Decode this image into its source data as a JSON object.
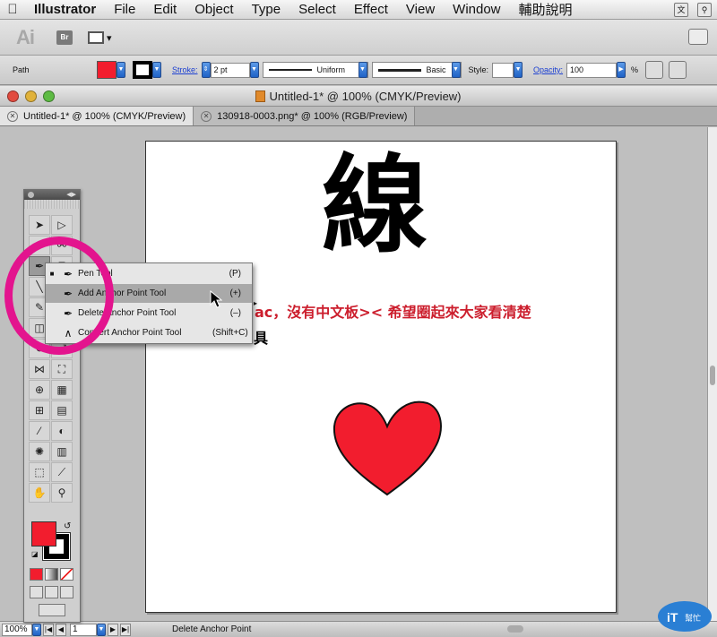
{
  "menubar": {
    "app": "Illustrator",
    "items": [
      "File",
      "Edit",
      "Object",
      "Type",
      "Select",
      "Effect",
      "View",
      "Window",
      "輔助說明"
    ]
  },
  "appbar": {
    "logo": "Ai",
    "bridge": "Br"
  },
  "control": {
    "label": "Path",
    "fill_color": "#f21d2e",
    "stroke_link": "Stroke:",
    "stroke_weight": "2 pt",
    "profile_uniform": "Uniform",
    "brush_basic": "Basic",
    "style_label": "Style:",
    "opacity_link": "Opacity:",
    "opacity_value": "100",
    "percent": "%"
  },
  "window": {
    "title": "Untitled-1* @ 100% (CMYK/Preview)"
  },
  "tabs": [
    {
      "label": "Untitled-1* @ 100% (CMYK/Preview)"
    },
    {
      "label": "130918-0003.png* @ 100% (RGB/Preview)"
    }
  ],
  "artboard": {
    "big_char": "線",
    "red_text": "ac，沒有中文板>< 希望圈起來大家看清楚",
    "small_char": "具"
  },
  "flyout": {
    "items": [
      {
        "name": "Pen Tool",
        "shortcut": "(P)"
      },
      {
        "name": "Add Anchor Point Tool",
        "shortcut": "(+)"
      },
      {
        "name": "Delete Anchor Point Tool",
        "shortcut": "(–)"
      },
      {
        "name": "Convert Anchor Point Tool",
        "shortcut": "(Shift+C)"
      }
    ]
  },
  "status": {
    "zoom": "100%",
    "page": "1",
    "current_tool": "Delete Anchor Point"
  },
  "colors": {
    "annotation": "#e3148e",
    "heart": "#f21d2e",
    "red_text": "#cc1e2d"
  }
}
